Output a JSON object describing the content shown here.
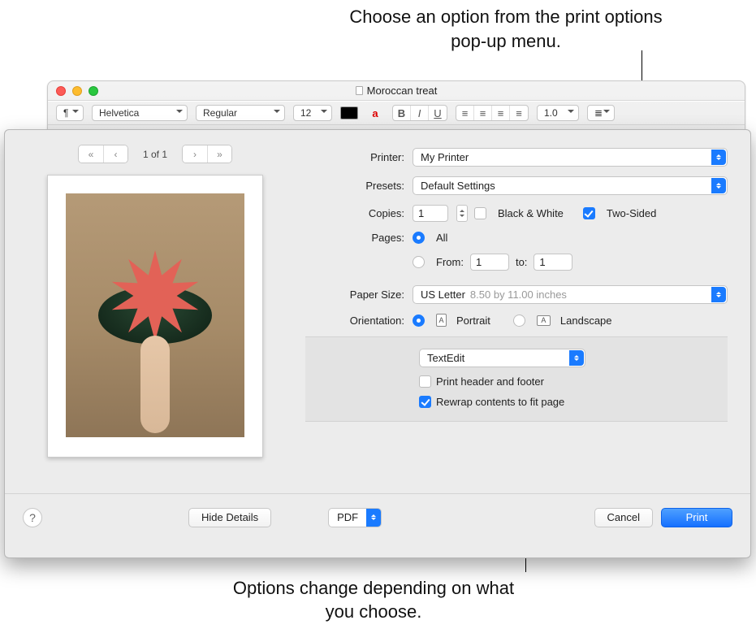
{
  "callouts": {
    "top": "Choose an option from the print options pop-up menu.",
    "bottom": "Options change depending on what you choose."
  },
  "window": {
    "title": "Moroccan treat",
    "toolbar": {
      "para": "¶",
      "font": "Helvetica",
      "style": "Regular",
      "size": "12",
      "spacing": "1.0"
    }
  },
  "dialog": {
    "preview": {
      "pager": "1 of 1"
    },
    "labels": {
      "printer": "Printer:",
      "presets": "Presets:",
      "copies": "Copies:",
      "pages": "Pages:",
      "paper": "Paper Size:",
      "orientation": "Orientation:"
    },
    "printer": "My Printer",
    "presets": "Default Settings",
    "copies": {
      "value": "1",
      "bw": "Black & White",
      "twoSided": "Two-Sided"
    },
    "pages": {
      "all": "All",
      "fromLabel": "From:",
      "from": "1",
      "toLabel": "to:",
      "to": "1"
    },
    "paper": {
      "name": "US Letter",
      "dim": "8.50 by 11.00 inches"
    },
    "orientation": {
      "portrait": "Portrait",
      "landscape": "Landscape"
    },
    "section": {
      "app": "TextEdit",
      "header": "Print header and footer",
      "rewrap": "Rewrap contents to fit page"
    },
    "footer": {
      "hide": "Hide Details",
      "pdf": "PDF",
      "cancel": "Cancel",
      "print": "Print"
    }
  }
}
